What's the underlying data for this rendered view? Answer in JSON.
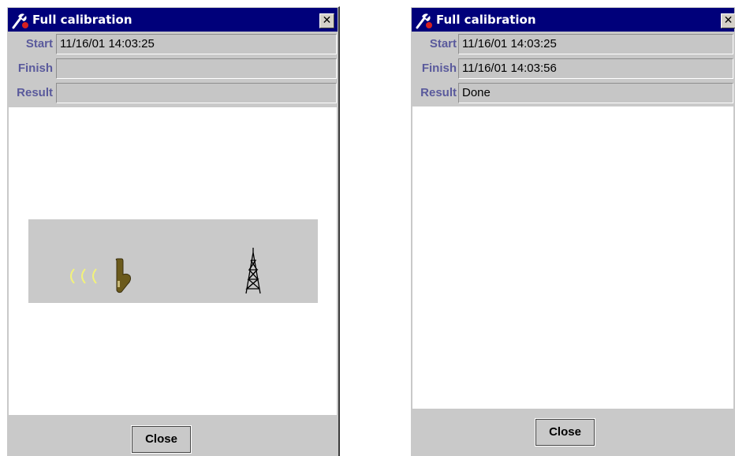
{
  "windows": [
    {
      "title": "Full calibration",
      "close_glyph": "✕",
      "start_label": "Start",
      "start_value": "11/16/01 14:03:25",
      "finish_label": "Finish",
      "finish_value": "",
      "result_label": "Result",
      "result_value": "",
      "arcs": "ccc",
      "close_button": "Close"
    },
    {
      "title": "Full calibration",
      "close_glyph": "✕",
      "start_label": "Start",
      "start_value": "11/16/01 14:03:25",
      "finish_label": "Finish",
      "finish_value": "11/16/01 14:03:56",
      "result_label": "Result",
      "result_value": "Done",
      "close_button": "Close"
    }
  ],
  "colors": {
    "titlebar": "#00007a",
    "label": "#5a5a9c",
    "panel": "#c9c9c9",
    "signal_arcs": "#f2f27a"
  },
  "icons": [
    "wrench-icon",
    "close-icon",
    "phone-icon",
    "signal-icon",
    "tower-icon"
  ]
}
